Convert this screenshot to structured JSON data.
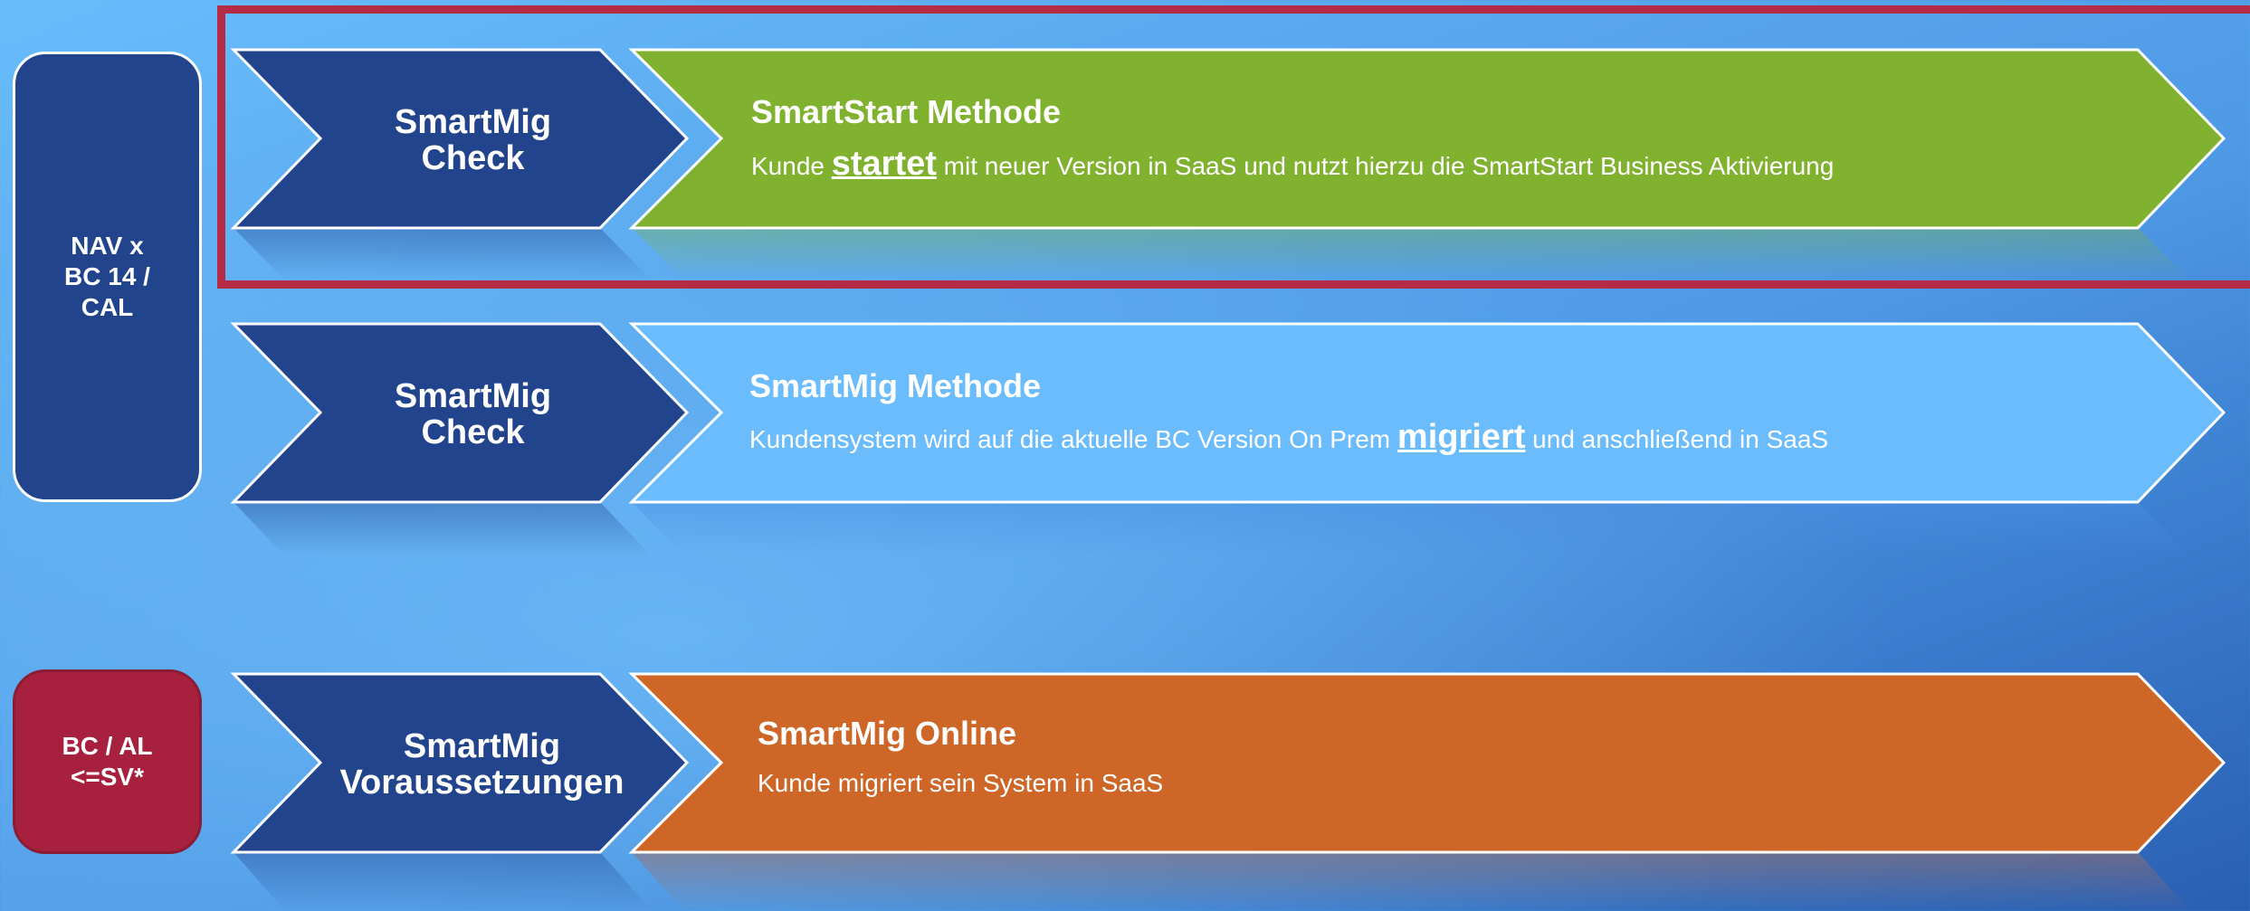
{
  "left_boxes": {
    "nav": "NAV x\nBC 14 /\nCAL",
    "bc": "BC / AL\n<=SV*"
  },
  "rows": [
    {
      "check_label": "SmartMig\nCheck",
      "title": "SmartStart Methode",
      "desc_before": "Kunde ",
      "desc_keyword": "startet",
      "desc_after": " mit neuer Version in SaaS und nutzt hierzu die SmartStart Business Aktivierung",
      "color": "#80b12f"
    },
    {
      "check_label": "SmartMig\nCheck",
      "title": "SmartMig Methode",
      "desc_before": "Kundensystem wird auf die aktuelle BC Version On Prem ",
      "desc_keyword": "migriert",
      "desc_after": " und anschließend in SaaS",
      "color": "#6abcfc"
    },
    {
      "check_label": "SmartMig\nVoraussetzungen",
      "title": "SmartMig Online",
      "desc_before": "Kunde migriert sein System in SaaS",
      "desc_keyword": "",
      "desc_after": "",
      "color": "#cd6627"
    }
  ],
  "colors": {
    "chevron_blue": "#21448c",
    "highlight_border": "#b52a45",
    "nav_box": "#21448c",
    "bc_box": "#a7213e"
  }
}
